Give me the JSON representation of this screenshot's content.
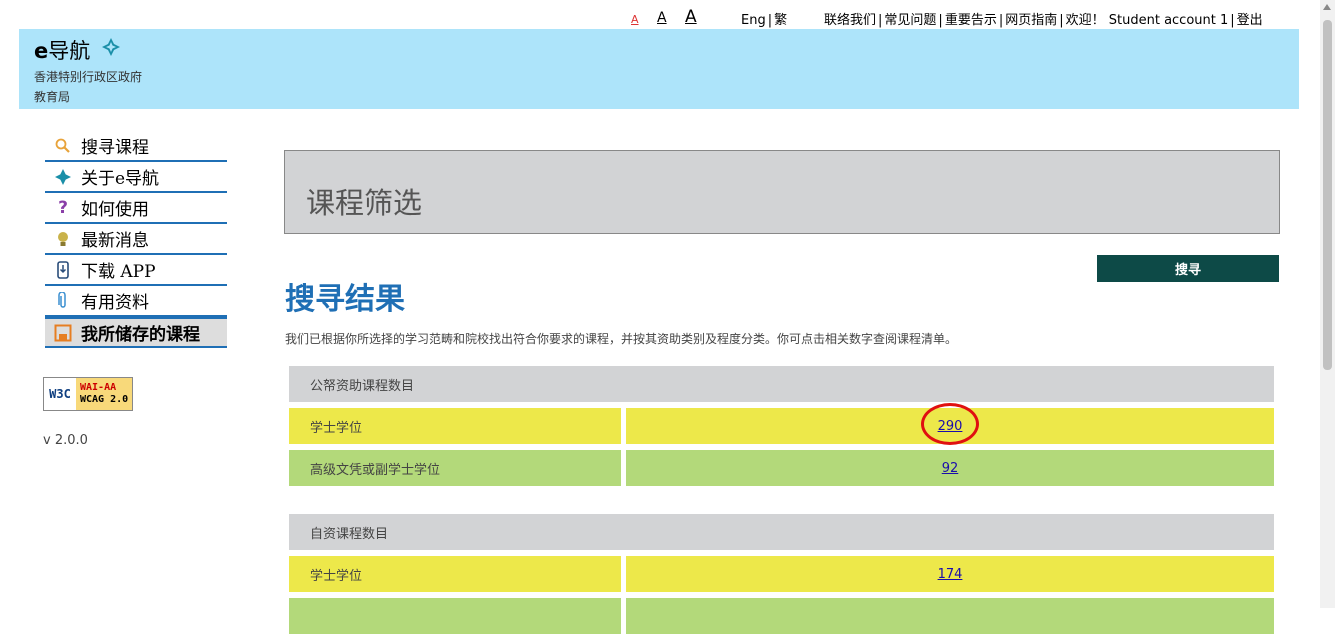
{
  "topbar": {
    "font_small": "A",
    "font_medium": "A",
    "font_large": "A",
    "lang_eng": "Eng",
    "lang_trad": "繁",
    "links": [
      "联络我们",
      "常见问题",
      "重要告示",
      "网页指南",
      "欢迎！ Student account 1",
      "登出"
    ]
  },
  "header": {
    "logo_e": "e",
    "logo_text": "导航",
    "gov_line1": "香港特别行政区政府",
    "gov_line2": "教育局"
  },
  "sidebar": {
    "items": [
      {
        "label": "搜寻课程",
        "icon": "search-icon"
      },
      {
        "label": "关于e导航",
        "icon": "logo-star-icon"
      },
      {
        "label": "如何使用",
        "icon": "question-icon"
      },
      {
        "label": "最新消息",
        "icon": "lightbulb-icon"
      },
      {
        "label": "下载 APP",
        "icon": "phone-download-icon"
      },
      {
        "label": "有用资料",
        "icon": "paperclip-icon"
      },
      {
        "label": "我所储存的课程",
        "icon": "save-icon"
      }
    ],
    "badge_left": "W3C",
    "badge_line1": "WAI-AA",
    "badge_line2": "WCAG 2.0",
    "version": "v 2.0.0"
  },
  "main": {
    "filter_title": "课程筛选",
    "search_button": "搜寻",
    "results_title": "搜寻结果",
    "description": "我们已根据你所选择的学习范畴和院校找出符合你要求的课程，并按其资助类别及程度分类。你可点击相关数字查阅课程清单。",
    "public_section": {
      "heading": "公帑资助课程数目",
      "rows": [
        {
          "label": "学士学位",
          "count": "290"
        },
        {
          "label": "高级文凭或副学士学位",
          "count": "92"
        }
      ]
    },
    "self_section": {
      "heading": "自资课程数目",
      "rows": [
        {
          "label": "学士学位",
          "count": "174"
        }
      ]
    }
  },
  "colors": {
    "header_bg": "#ade4fa",
    "accent_blue": "#1f6fb5",
    "button_bg": "#0d4a47",
    "row_yellow": "#ede84a",
    "row_green": "#b3d97a",
    "highlight_circle": "#e01010"
  }
}
